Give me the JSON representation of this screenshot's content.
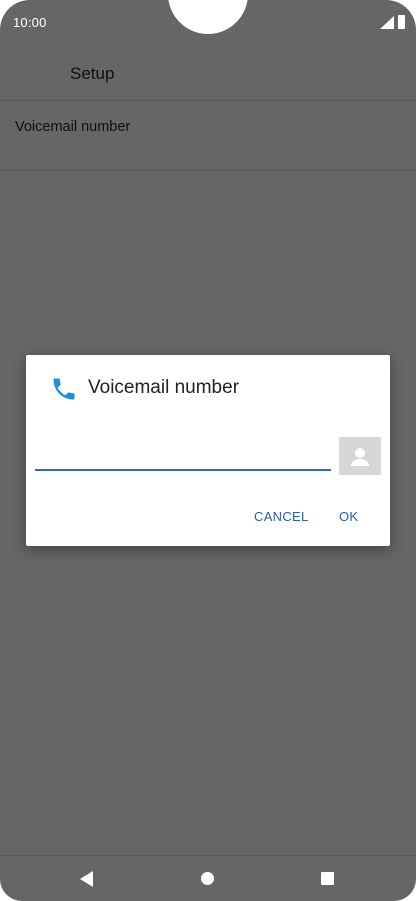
{
  "status_bar": {
    "time": "10:00",
    "signal_icon": "signal-icon",
    "battery_icon": "battery-icon"
  },
  "app_bar": {
    "title": "Setup"
  },
  "settings": {
    "items": [
      {
        "label": "Voicemail number"
      }
    ]
  },
  "dialog": {
    "icon": "phone-icon",
    "title": "Voicemail number",
    "input_value": "",
    "contact_icon": "contact-picker-icon",
    "cancel_label": "CANCEL",
    "ok_label": "OK",
    "accent_color": "#2a5db0",
    "icon_color": "#1e8fe0"
  },
  "nav_bar": {
    "back_icon": "back-icon",
    "home_icon": "home-icon",
    "recents_icon": "recents-icon"
  }
}
